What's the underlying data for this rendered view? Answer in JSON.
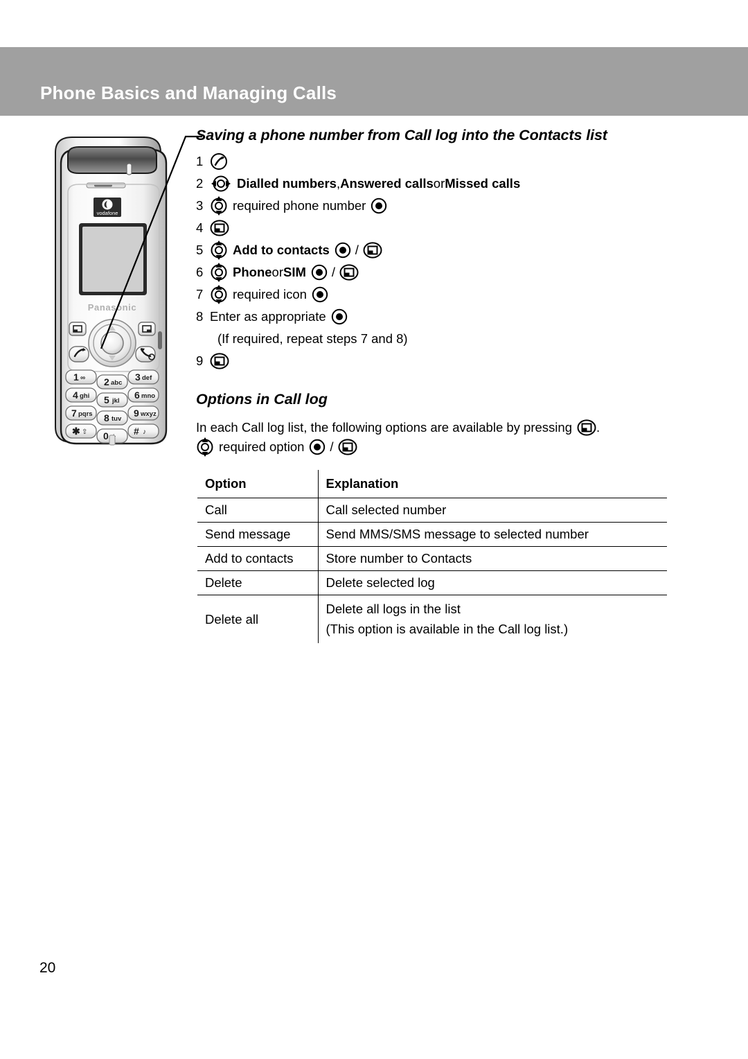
{
  "header": {
    "title": "Phone Basics and Managing Calls",
    "band_color": "#a0a0a0"
  },
  "section": {
    "heading": "Saving a phone number from Call log into the Contacts list",
    "steps": [
      {
        "num": "1",
        "icons": [
          "call-key-icon"
        ],
        "text": ""
      },
      {
        "num": "2",
        "icons": [
          "nav-left-right-icon"
        ],
        "text": "Dialled numbers, Answered calls or Missed calls",
        "runs": [
          {
            "t": "Dialled numbers",
            "bold": true
          },
          {
            "t": ", ",
            "bold": false
          },
          {
            "t": "Answered calls",
            "bold": true
          },
          {
            "t": " or ",
            "bold": false
          },
          {
            "t": "Missed calls",
            "bold": true
          }
        ]
      },
      {
        "num": "3",
        "icons": [
          "nav-up-down-icon"
        ],
        "text": "required phone number",
        "trailing_icons": [
          "select-key-icon"
        ]
      },
      {
        "num": "4",
        "icons": [
          "left-softkey-icon"
        ],
        "text": ""
      },
      {
        "num": "5",
        "icons": [
          "nav-up-down-icon"
        ],
        "text": "Add to contacts",
        "bold": true,
        "trailing_icons": [
          "select-key-icon",
          "left-softkey-icon"
        ]
      },
      {
        "num": "6",
        "icons": [
          "nav-up-down-icon"
        ],
        "text": "Phone or SIM",
        "runs": [
          {
            "t": "Phone",
            "bold": true
          },
          {
            "t": " or ",
            "bold": false
          },
          {
            "t": "SIM",
            "bold": true
          }
        ],
        "trailing_icons": [
          "select-key-icon",
          "left-softkey-icon"
        ]
      },
      {
        "num": "7",
        "icons": [
          "nav-up-down-icon"
        ],
        "text": "required icon",
        "trailing_icons": [
          "select-key-icon"
        ]
      },
      {
        "num": "8",
        "icons": [],
        "text": "Enter as appropriate",
        "trailing_icons": [
          "select-key-icon"
        ]
      }
    ],
    "note": "(If required, repeat steps 7 and 8)",
    "final_step": {
      "num": "9",
      "icons": [
        "left-softkey-icon"
      ]
    }
  },
  "options_section": {
    "heading": "Options in Call log",
    "intro_before": "In each Call log list, the following options are available by pressing",
    "intro_after": ".",
    "select_line": {
      "text": "required option",
      "separator": "/"
    },
    "table": {
      "columns": [
        "Option",
        "Explanation"
      ],
      "rows": [
        {
          "option": "Call",
          "explanation": [
            "Call selected number"
          ]
        },
        {
          "option": "Send message",
          "explanation": [
            "Send MMS/SMS message to selected number"
          ]
        },
        {
          "option": "Add to contacts",
          "explanation": [
            "Store number to Contacts"
          ]
        },
        {
          "option": "Delete",
          "explanation": [
            "Delete selected log"
          ]
        },
        {
          "option": "Delete all",
          "explanation": [
            "Delete all logs in the list",
            "(This option is available in the Call log list.)"
          ]
        }
      ]
    }
  },
  "phone_illustration": {
    "brand": "Panasonic",
    "carrier_logo": "vodafone",
    "keys": [
      {
        "digit": "1",
        "letters": "∞"
      },
      {
        "digit": "2",
        "letters": "abc"
      },
      {
        "digit": "3",
        "letters": "def"
      },
      {
        "digit": "4",
        "letters": "ghi"
      },
      {
        "digit": "5",
        "letters": "jkl"
      },
      {
        "digit": "6",
        "letters": "mno"
      },
      {
        "digit": "7",
        "letters": "pqrs"
      },
      {
        "digit": "8",
        "letters": "tuv"
      },
      {
        "digit": "9",
        "letters": "wxyz"
      },
      {
        "digit": "∗",
        "letters": "⇧"
      },
      {
        "digit": "0",
        "letters": "+"
      },
      {
        "digit": "#",
        "letters": "♪"
      }
    ]
  },
  "page_number": "20"
}
